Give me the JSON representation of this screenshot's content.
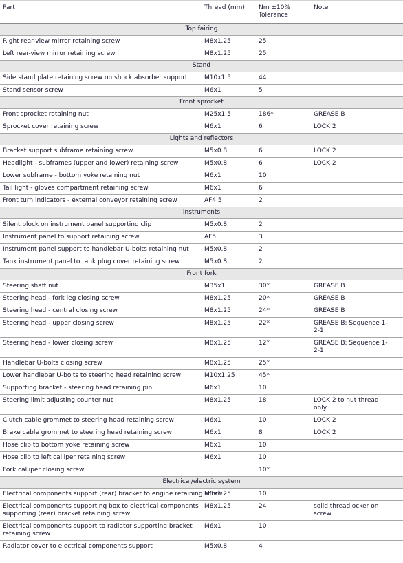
{
  "table": {
    "columns": [
      {
        "key": "part",
        "label": "Part"
      },
      {
        "key": "thread",
        "label": "Thread (mm)"
      },
      {
        "key": "nm",
        "label": "Nm ±10%\nTolerance"
      },
      {
        "key": "note",
        "label": "Note"
      }
    ],
    "sections": [
      {
        "title": "Top fairing",
        "rows": [
          {
            "part": "Right rear-view mirror retaining screw",
            "thread": "M8x1.25",
            "nm": "25",
            "note": ""
          },
          {
            "part": "Left rear-view mirror retaining screw",
            "thread": "M8x1.25",
            "nm": "25",
            "note": ""
          }
        ]
      },
      {
        "title": "Stand",
        "rows": [
          {
            "part": "Side stand plate retaining screw on shock absorber support",
            "thread": "M10x1.5",
            "nm": "44",
            "note": ""
          },
          {
            "part": "Stand sensor screw",
            "thread": "M6x1",
            "nm": "5",
            "note": ""
          }
        ]
      },
      {
        "title": "Front sprocket",
        "rows": [
          {
            "part": "Front sprocket retaining nut",
            "thread": "M25x1.5",
            "nm": "186*",
            "note": "GREASE B"
          },
          {
            "part": "Sprocket cover retaining screw",
            "thread": "M6x1",
            "nm": "6",
            "note": "LOCK 2"
          }
        ]
      },
      {
        "title": "Lights and reflectors",
        "rows": [
          {
            "part": "Bracket support subframe retaining screw",
            "thread": "M5x0.8",
            "nm": "6",
            "note": "LOCK 2"
          },
          {
            "part": "Headlight - subframes (upper and lower) retaining screw",
            "thread": "M5x0.8",
            "nm": "6",
            "note": "LOCK 2"
          },
          {
            "part": "Lower subframe - bottom yoke retaining nut",
            "thread": "M6x1",
            "nm": "10",
            "note": ""
          },
          {
            "part": "Tail light - gloves compartment retaining screw",
            "thread": "M6x1",
            "nm": "6",
            "note": ""
          },
          {
            "part": "Front turn indicators - external conveyor retaining screw",
            "thread": "AF4.5",
            "nm": "2",
            "note": ""
          }
        ]
      },
      {
        "title": "Instruments",
        "rows": [
          {
            "part": "Silent block on instrument panel supporting clip",
            "thread": "M5x0.8",
            "nm": "2",
            "note": ""
          },
          {
            "part": "Instrument panel to support retaining screw",
            "thread": "AF5",
            "nm": "3",
            "note": ""
          },
          {
            "part": "Instrument panel support to handlebar U-bolts retaining nut",
            "thread": "M5x0.8",
            "nm": "2",
            "note": ""
          },
          {
            "part": "Tank instrument panel to tank plug cover retaining screw",
            "thread": "M5x0.8",
            "nm": "2",
            "note": ""
          }
        ]
      },
      {
        "title": "Front fork",
        "rows": [
          {
            "part": "Steering shaft nut",
            "thread": "M35x1",
            "nm": "30*",
            "note": "GREASE B"
          },
          {
            "part": "Steering head - fork leg closing screw",
            "thread": "M8x1.25",
            "nm": "20*",
            "note": "GREASE B"
          },
          {
            "part": "Steering head - central closing screw",
            "thread": "M8x1.25",
            "nm": "24*",
            "note": "GREASE B"
          },
          {
            "part": "Steering head - upper closing screw",
            "thread": "M8x1.25",
            "nm": "22*",
            "note": "GREASE B: Sequence 1-2-1"
          },
          {
            "part": "Steering head - lower closing screw",
            "thread": "M8x1.25",
            "nm": "12*",
            "note": "GREASE B: Sequence 1-2-1"
          },
          {
            "part": "Handlebar U-bolts closing screw",
            "thread": "M8x1.25",
            "nm": "25*",
            "note": ""
          },
          {
            "part": "Lower handlebar U-bolts to steering head retaining screw",
            "thread": "M10x1.25",
            "nm": "45*",
            "note": ""
          },
          {
            "part": "Supporting bracket - steering head retaining pin",
            "thread": "M6x1",
            "nm": "10",
            "note": ""
          },
          {
            "part": "Steering limit adjusting counter nut",
            "thread": "M8x1.25",
            "nm": "18",
            "note": "LOCK 2 to nut thread only"
          },
          {
            "part": "Clutch cable grommet to steering head retaining screw",
            "thread": "M6x1",
            "nm": "10",
            "note": "LOCK 2",
            "overflow": true
          },
          {
            "part": "Brake cable grommet to steering head retaining screw",
            "thread": "M6x1",
            "nm": "8",
            "note": "LOCK 2",
            "overflow": true
          },
          {
            "part": "Hose clip to bottom yoke retaining screw",
            "thread": "M6x1",
            "nm": "10",
            "note": ""
          },
          {
            "part": "Hose clip to left calliper retaining screw",
            "thread": "M6x1",
            "nm": "10",
            "note": ""
          },
          {
            "part": "Fork calliper closing screw",
            "thread": "",
            "nm": "10*",
            "note": ""
          }
        ]
      },
      {
        "title": "Electrical/electric system",
        "rows": [
          {
            "part": "Electrical components support (rear) bracket to engine retaining screw",
            "thread": "M8x1.25",
            "nm": "10",
            "note": "",
            "overflow": true
          },
          {
            "part": "Electrical components supporting box to electrical components supporting (rear) bracket retaining screw",
            "thread": "M8x1.25",
            "nm": "24",
            "note": "solid threadlocker on screw"
          },
          {
            "part": "Electrical components support to radiator supporting bracket retaining screw",
            "thread": "M6x1",
            "nm": "10",
            "note": ""
          },
          {
            "part": "Radiator cover to electrical components support",
            "thread": "M5x0.8",
            "nm": "4",
            "note": ""
          }
        ]
      }
    ]
  }
}
